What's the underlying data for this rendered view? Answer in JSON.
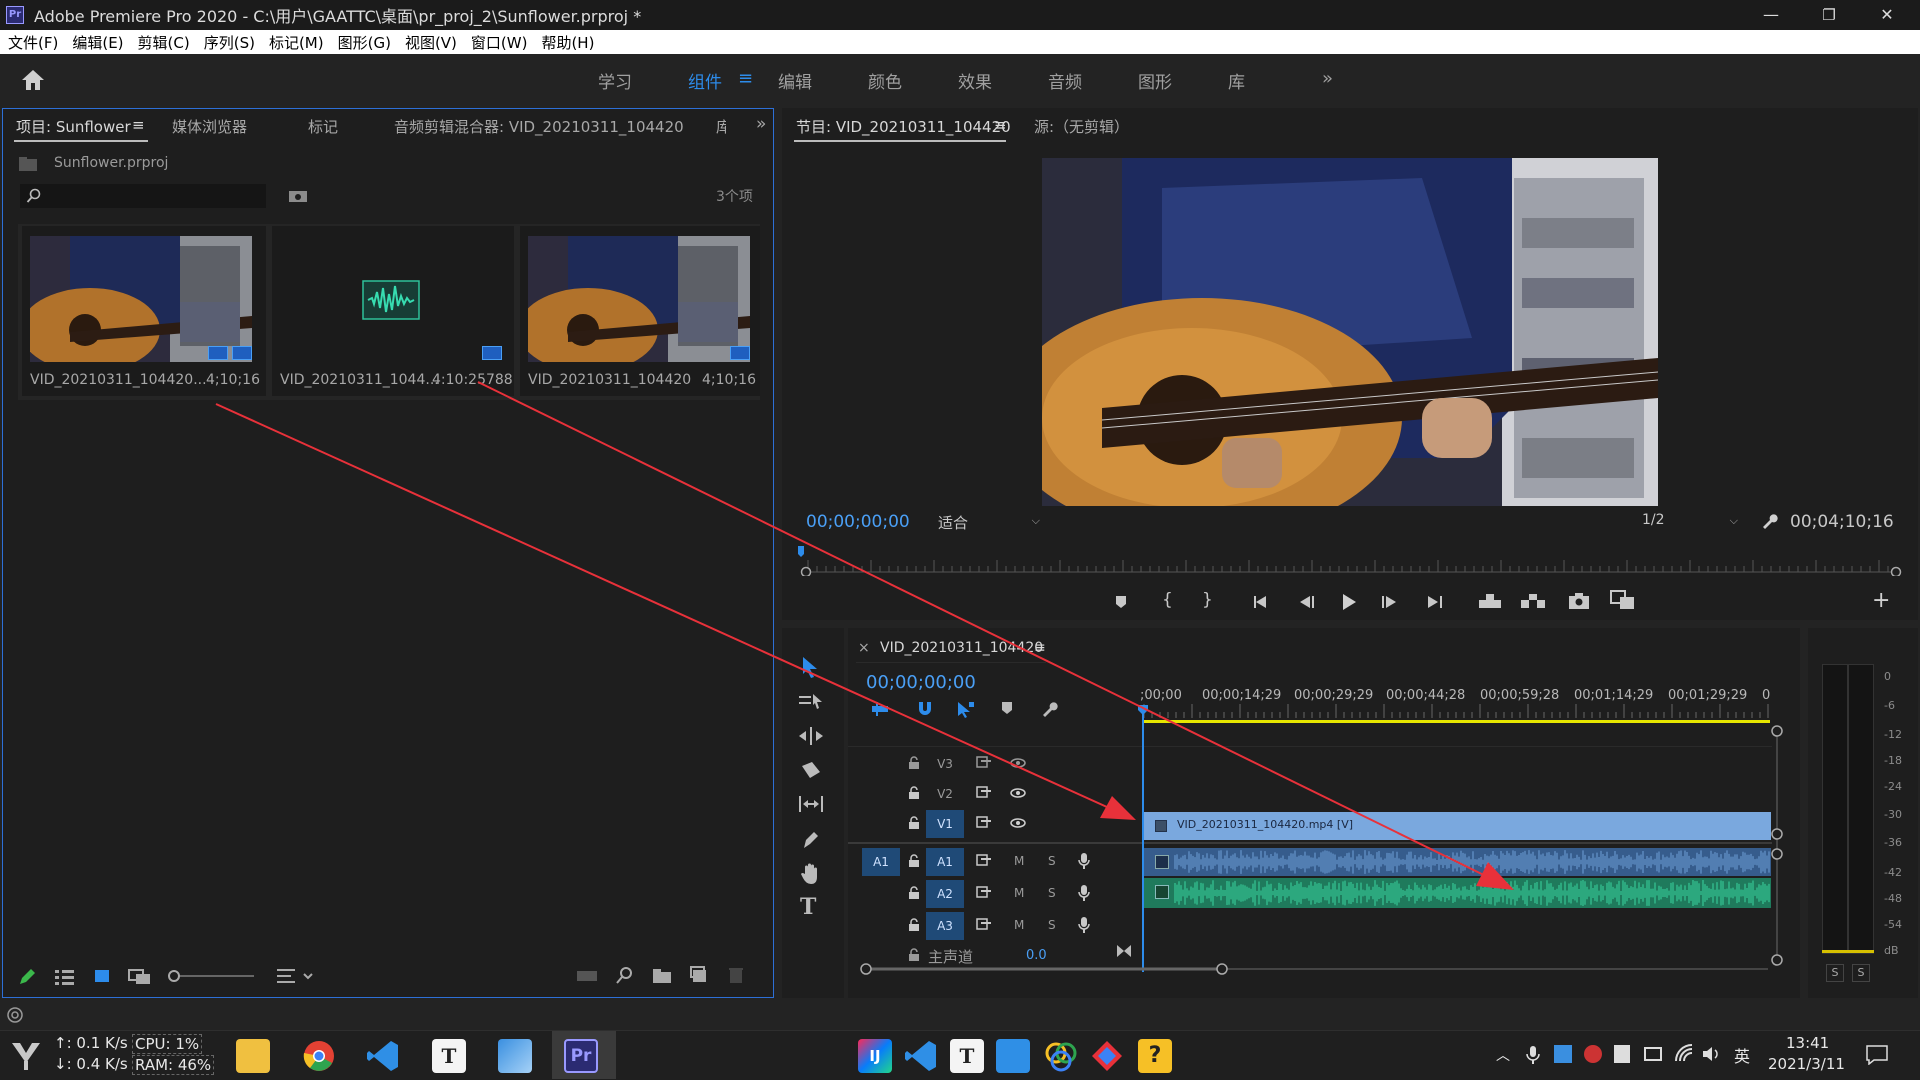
{
  "window": {
    "title": "Adobe Premiere Pro 2020 - C:\\用户\\GAATTC\\桌面\\pr_proj_2\\Sunflower.prproj *",
    "logo_label": "Pr",
    "minimize": "—",
    "restore": "❐",
    "close": "✕"
  },
  "menu": [
    "文件(F)",
    "编辑(E)",
    "剪辑(C)",
    "序列(S)",
    "标记(M)",
    "图形(G)",
    "视图(V)",
    "窗口(W)",
    "帮助(H)"
  ],
  "workspaces": {
    "tabs": [
      "学习",
      "组件",
      "编辑",
      "颜色",
      "效果",
      "音频",
      "图形",
      "库"
    ],
    "active": "组件",
    "menu_icon": "≡",
    "more": "»"
  },
  "project_panel": {
    "tabs": [
      "项目: Sunflower",
      "媒体浏览器",
      "标记",
      "音频剪辑混合器: VID_20210311_104420",
      "库"
    ],
    "tab_menu": "≡",
    "overflow": "»",
    "project_file": "Sunflower.prproj",
    "search_placeholder": "",
    "item_count": "3个项",
    "items": [
      {
        "name": "VID_20210311_104420...",
        "duration": "4;10;16"
      },
      {
        "name": "VID_20210311_1044...",
        "duration": "4:10:25788"
      },
      {
        "name": "VID_20210311_104420",
        "duration": "4;10;16"
      }
    ]
  },
  "program_monitor": {
    "tab": "节目: VID_20210311_104420",
    "tab_menu": "≡",
    "source_tab": "源:（无剪辑）",
    "timecode": "00;00;00;00",
    "fit": "适合",
    "resolution": "1/2",
    "duration": "00;04;10;16",
    "add_button": "+"
  },
  "timeline": {
    "close": "×",
    "sequence_name": "VID_20210311_104420",
    "seq_menu": "≡",
    "timecode": "00;00;00;00",
    "ruler": [
      ";00;00",
      "00;00;14;29",
      "00;00;29;29",
      "00;00;44;28",
      "00;00;59;28",
      "00;01;14;29",
      "00;01;29;29",
      "0"
    ],
    "video_tracks": [
      "V3",
      "V2",
      "V1"
    ],
    "audio_tracks": [
      "A1",
      "A2",
      "A3"
    ],
    "source_patch": "A1",
    "mute": "M",
    "solo": "S",
    "master_label": "主声道",
    "master_value": "0.0",
    "video_clip": "VID_20210311_104420.mp4 [V]"
  },
  "audio_meter": {
    "ticks": [
      "0",
      "-6",
      "-12",
      "-18",
      "-24",
      "-30",
      "-36",
      "-42",
      "-48",
      "-54",
      "dB"
    ],
    "solo_left": "S",
    "solo_right": "S"
  },
  "taskbar": {
    "net_up": "↑: 0.1 K/s",
    "net_down": "↓: 0.4 K/s",
    "cpu": "CPU:  1%",
    "ram": "RAM: 46%",
    "pinned_letters": [
      "T",
      "Pr"
    ],
    "tray_letters": [
      "IJ",
      "T",
      "?"
    ],
    "ime": "英",
    "clock_time": "13:41",
    "clock_date": "2021/3/11"
  },
  "colors": {
    "accent_blue": "#2d8ceb",
    "timecode_blue": "#4a9ff5",
    "video_clip": "#7aa8de",
    "audio_clip": "#2e9e76",
    "arrow_red": "#e8313a",
    "work_area_yellow": "#e6e600"
  }
}
